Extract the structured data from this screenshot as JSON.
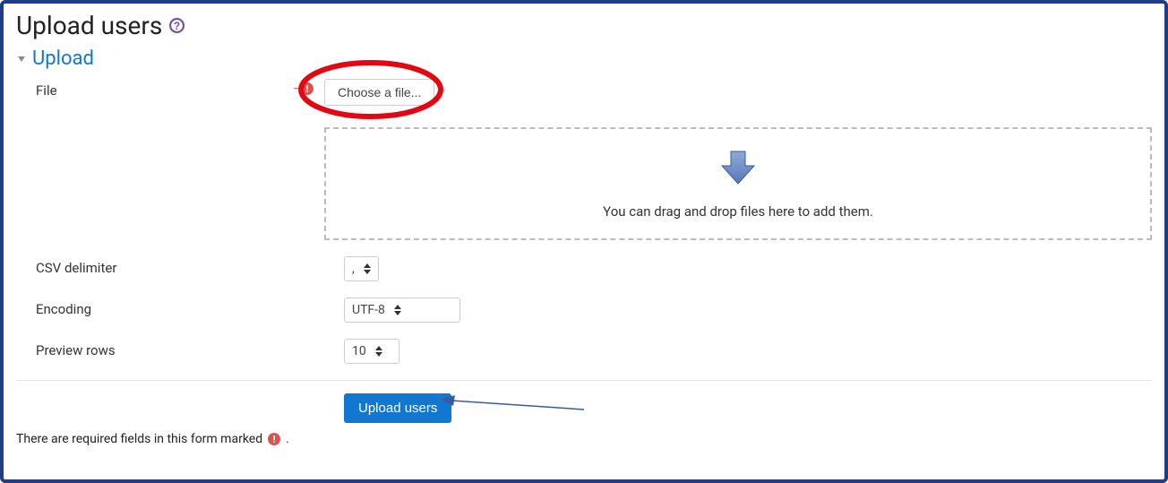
{
  "page": {
    "title": "Upload users"
  },
  "section": {
    "title": "Upload"
  },
  "form": {
    "file": {
      "label": "File",
      "choose_button": "Choose a file...",
      "dropzone_hint": "You can drag and drop files here to add them."
    },
    "csv_delimiter": {
      "label": "CSV delimiter",
      "value": ","
    },
    "encoding": {
      "label": "Encoding",
      "value": "UTF-8"
    },
    "preview_rows": {
      "label": "Preview rows",
      "value": "10"
    },
    "submit_label": "Upload users"
  },
  "footer": {
    "required_note_prefix": "There are required fields in this form marked",
    "required_note_suffix": "."
  }
}
